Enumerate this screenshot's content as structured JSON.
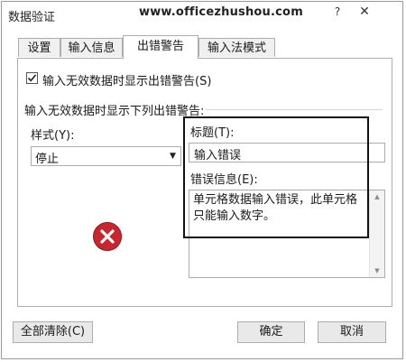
{
  "window": {
    "title": "数据验证",
    "watermark": "www.officezhushou.com",
    "help_glyph": "?",
    "close_glyph": "✕"
  },
  "tabs": [
    {
      "label": "设置"
    },
    {
      "label": "输入信息"
    },
    {
      "label": "出错警告",
      "selected": true
    },
    {
      "label": "输入法模式"
    }
  ],
  "panel": {
    "show_alert_checkbox": {
      "label": "输入无效数据时显示出错警告(S)",
      "checked": true
    },
    "section_label": "输入无效数据时显示下列出错警告:",
    "style": {
      "label": "样式(Y):",
      "value": "停止",
      "icon": "error-stop-icon"
    },
    "title": {
      "label": "标题(T):",
      "value": "输入错误"
    },
    "message": {
      "label": "错误信息(E):",
      "value": "单元格数据输入错误，此单元格只能输入数字。"
    }
  },
  "buttons": {
    "clear_all": "全部清除(C)",
    "ok": "确定",
    "cancel": "取消"
  },
  "colors": {
    "error_icon": "#c8262e",
    "highlight_border": "#111111"
  }
}
